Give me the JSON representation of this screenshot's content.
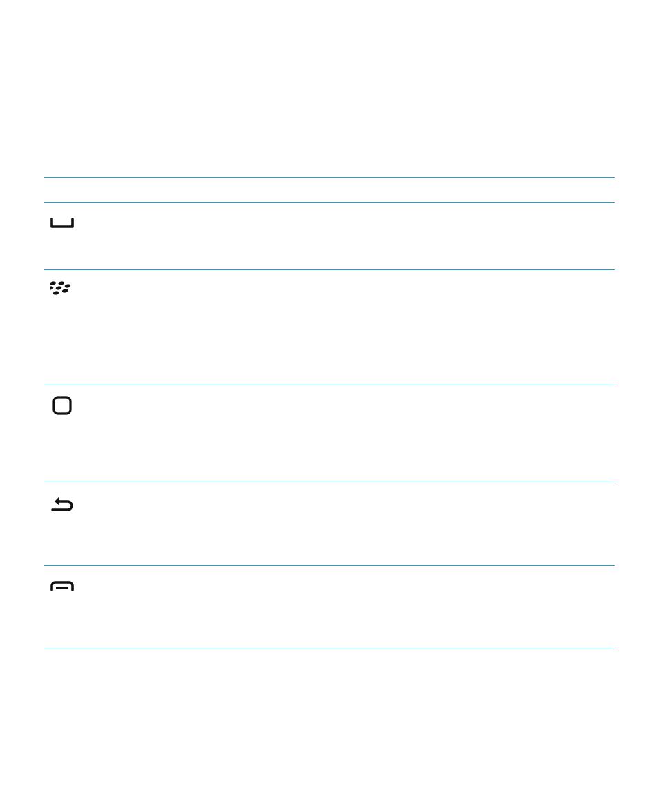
{
  "table": {
    "border_color": "#1fa3d4",
    "icon_color": "#111111",
    "rows": [
      {
        "icon": "send-key-icon"
      },
      {
        "icon": "blackberry-menu-key-icon"
      },
      {
        "icon": "trackpad-key-icon"
      },
      {
        "icon": "escape-back-key-icon"
      },
      {
        "icon": "end-power-key-icon"
      }
    ]
  }
}
